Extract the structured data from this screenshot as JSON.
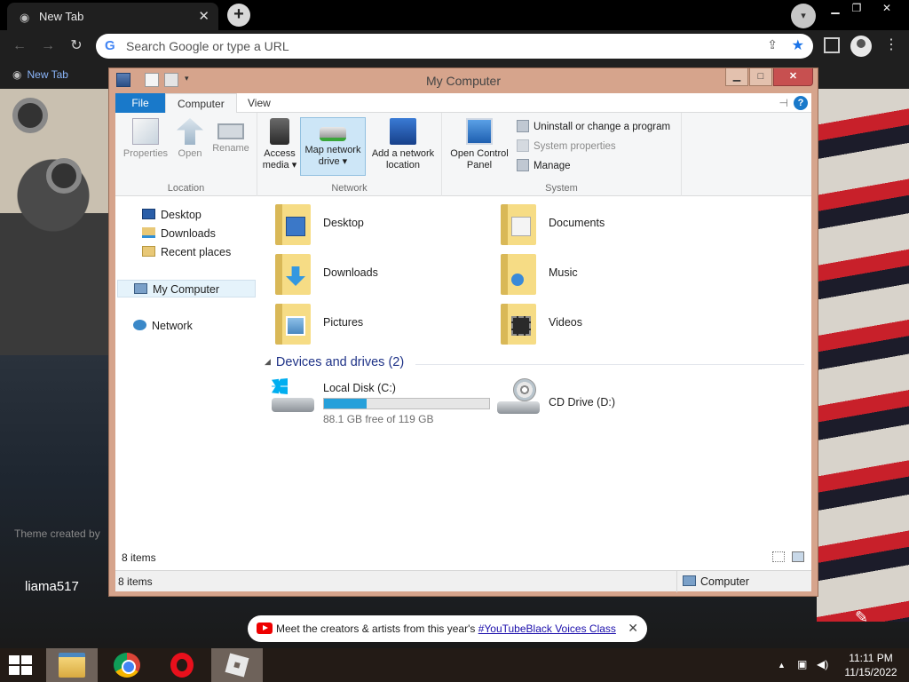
{
  "browser": {
    "tab_title": "New Tab",
    "tab_close": "✕",
    "newtab_glyph": "+",
    "omnibox_placeholder": "Search Google or type a URL",
    "bookmark_label": "New Tab"
  },
  "ntp": {
    "theme_credit": "Theme created by",
    "username": "liama517",
    "yt_banner": {
      "text": "Meet the creators & artists from this year's ",
      "link": "#YouTubeBlack Voices Class",
      "close": "✕"
    }
  },
  "explorer": {
    "title": "My Computer",
    "ribbon_tabs": [
      "File",
      "Computer",
      "View"
    ],
    "active_tab": "Computer",
    "groups": {
      "location": {
        "label": "Location",
        "buttons": [
          "Properties",
          "Open",
          "Rename"
        ]
      },
      "network": {
        "label": "Network",
        "access_media": [
          "Access",
          "media ▾"
        ],
        "map_drive": [
          "Map network",
          "drive ▾"
        ],
        "add_location": [
          "Add a network",
          "location"
        ]
      },
      "system": {
        "label": "System",
        "open_cpl": [
          "Open Control",
          "Panel"
        ],
        "uninstall": "Uninstall or change a program",
        "sys_props": "System properties",
        "manage": "Manage"
      }
    },
    "nav": {
      "desktop": "Desktop",
      "downloads": "Downloads",
      "recent": "Recent places",
      "computer": "My Computer",
      "network": "Network"
    },
    "folders": [
      "Desktop",
      "Documents",
      "Downloads",
      "Music",
      "Pictures",
      "Videos"
    ],
    "devices_header": "Devices and drives (2)",
    "drives": {
      "c": {
        "name": "Local Disk (C:)",
        "free": "88.1 GB free of 119 GB",
        "used_fraction": 0.26
      },
      "d": {
        "name": "CD Drive (D:)"
      }
    },
    "status": {
      "item_count": "8 items",
      "location": "Computer"
    }
  },
  "taskbar": {
    "time": "11:11 PM",
    "date": "11/15/2022"
  }
}
